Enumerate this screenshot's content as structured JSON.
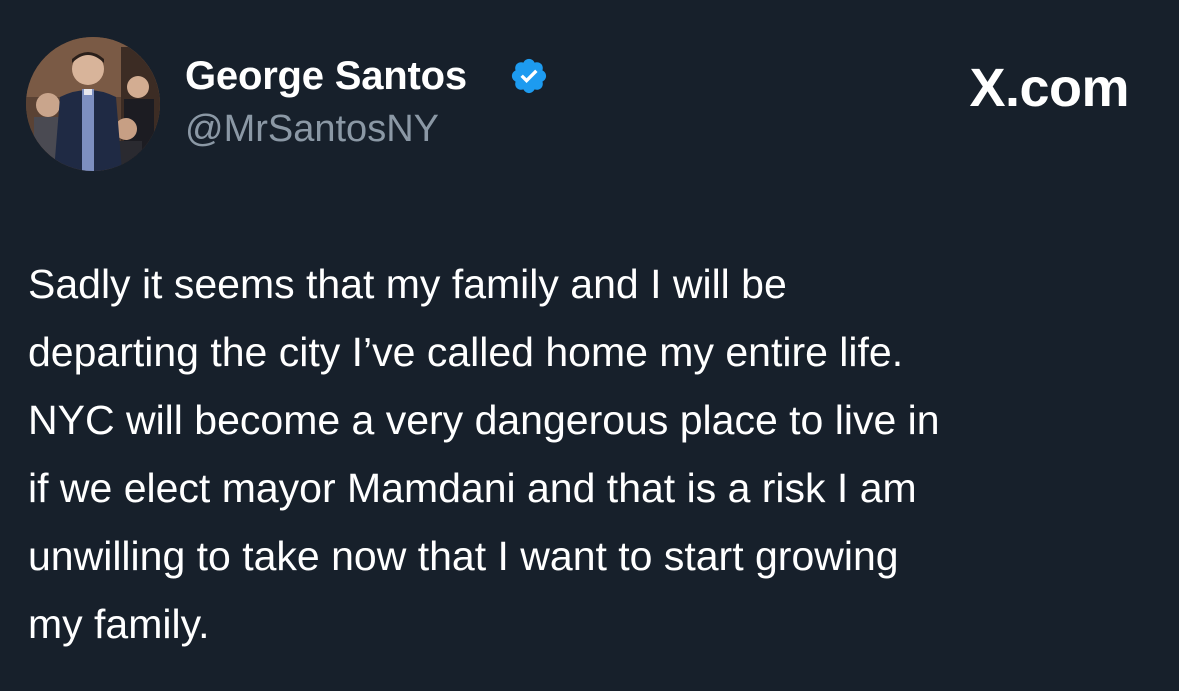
{
  "author": {
    "display_name": "George Santos",
    "handle": "@MrSantosNY",
    "verified": true,
    "avatar_icon": "profile-photo"
  },
  "brand": {
    "label": "X.com"
  },
  "tweet": {
    "lines": [
      "Sadly it seems that my family and I will be",
      "departing the city I’ve called home my entire life.",
      "NYC will become a very dangerous place to live in",
      "if we elect mayor Mamdani and that is a risk I am",
      "unwilling to take now that I want to start growing",
      "my family."
    ]
  },
  "colors": {
    "background": "#17202b",
    "text_primary": "#ffffff",
    "text_secondary": "#8b98a5",
    "verified_blue": "#1d9bf0"
  }
}
